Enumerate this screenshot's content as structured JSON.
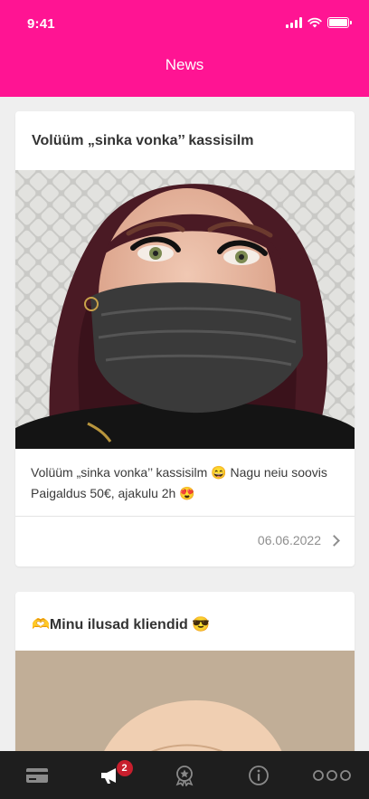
{
  "status_bar": {
    "time": "9:41"
  },
  "header": {
    "title": "News"
  },
  "posts": [
    {
      "title": "Volüüm „sinka vonka’’ kassisilm",
      "body": "Volüüm „sinka vonka’’ kassisilm 😄 Nagu neiu soovis Paigaldus 50€, ajakulu 2h 😍",
      "date": "06.06.2022"
    },
    {
      "title": "🫶Minu ilusad kliendid 😎"
    }
  ],
  "tabbar": {
    "tabs": [
      {
        "icon": "card-icon"
      },
      {
        "icon": "megaphone-icon",
        "badge": "2",
        "active": true
      },
      {
        "icon": "award-icon"
      },
      {
        "icon": "info-icon"
      },
      {
        "icon": "more-icon"
      }
    ]
  },
  "colors": {
    "accent": "#ff1493",
    "tabbar": "#1e1e1e",
    "badge": "#c81e2d"
  }
}
